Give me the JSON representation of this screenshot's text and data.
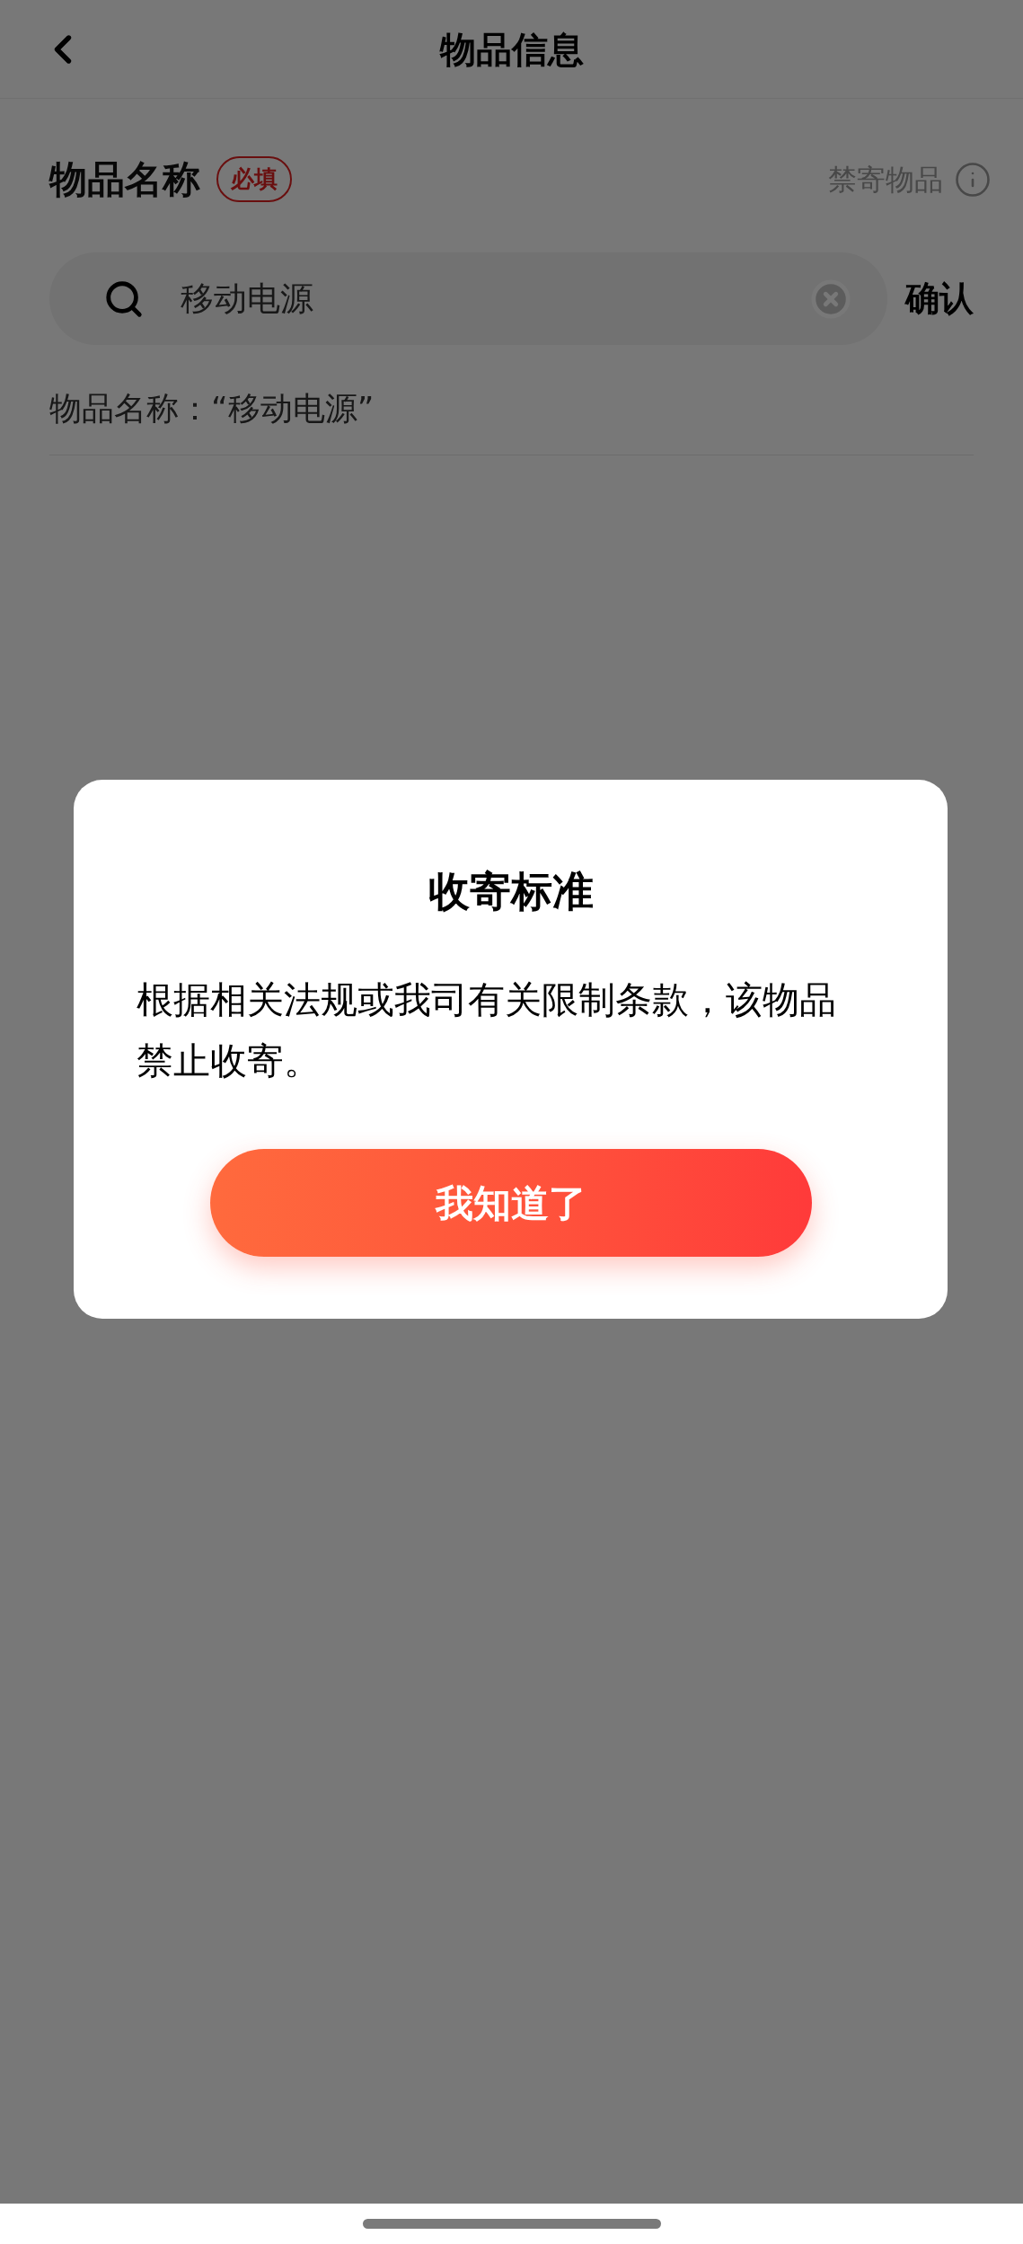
{
  "nav": {
    "title": "物品信息"
  },
  "item_name": {
    "label": "物品名称",
    "required_badge": "必填",
    "prohibited_link": "禁寄物品"
  },
  "search": {
    "value": "移动电源",
    "confirm": "确认"
  },
  "suggestions": [
    "物品名称：“移动电源”"
  ],
  "dialog": {
    "title": "收寄标准",
    "message": "根据相关法规或我司有关限制条款，该物品禁止收寄。",
    "button": "我知道了"
  }
}
